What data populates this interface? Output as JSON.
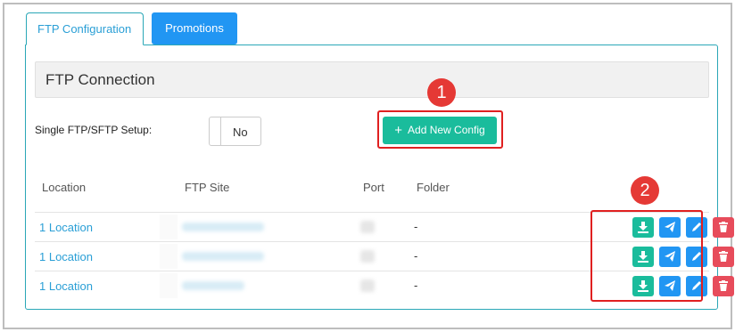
{
  "tabs": [
    {
      "label": "FTP Configuration",
      "active": true
    },
    {
      "label": "Promotions",
      "active": false
    }
  ],
  "section": {
    "title": "FTP Connection"
  },
  "setup": {
    "label": "Single FTP/SFTP Setup:",
    "toggle_value": "No"
  },
  "add_button": {
    "label": "Add New Config",
    "icon": "plus-icon"
  },
  "markers": [
    "1",
    "2"
  ],
  "table": {
    "columns": [
      "Location",
      "FTP Site",
      "Port",
      "Folder"
    ],
    "rows": [
      {
        "location": "1 Location",
        "folder": "-"
      },
      {
        "location": "1 Location",
        "folder": "-"
      },
      {
        "location": "1 Location",
        "folder": "-"
      }
    ],
    "actions": [
      "download-icon",
      "send-icon",
      "edit-icon",
      "delete-icon"
    ]
  },
  "colors": {
    "accent": "#2196f3",
    "teal": "#1abc9c",
    "danger": "#e74c5b",
    "highlight": "#e02020",
    "link": "#2a9fd6"
  }
}
